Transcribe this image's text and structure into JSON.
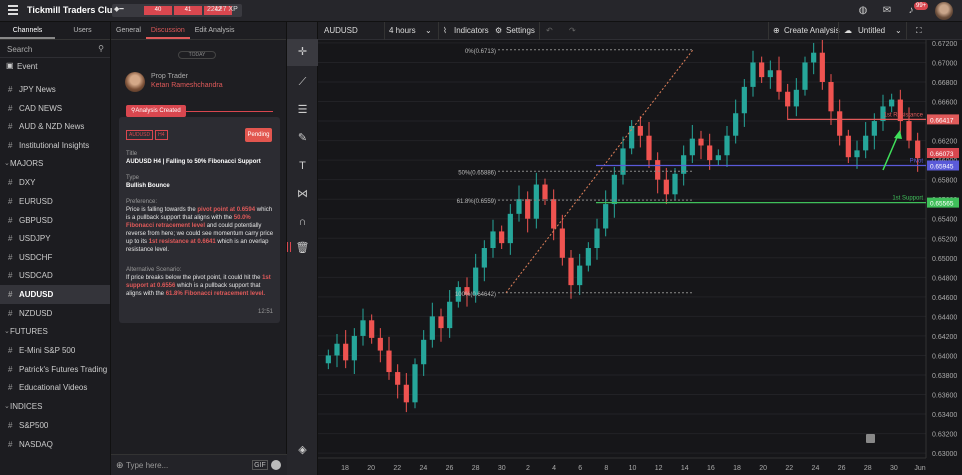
{
  "app": {
    "title": "Tickmill Traders Club",
    "xp": "22127 XP",
    "xp_segments": [
      "40",
      "41",
      "42"
    ],
    "notifications": "99+"
  },
  "sidebar": {
    "tabs": [
      "Channels",
      "Users"
    ],
    "search_placeholder": "Search",
    "event_label": "Event",
    "top_items": [
      "JPY News",
      "CAD NEWS",
      "AUD & NZD News",
      "Institutional Insights"
    ],
    "sections": [
      {
        "title": "MAJORS",
        "items": [
          "DXY",
          "EURUSD",
          "GBPUSD",
          "USDJPY",
          "USDCHF",
          "USDCAD",
          "AUDUSD",
          "NZDUSD"
        ]
      },
      {
        "title": "FUTURES",
        "items": [
          "E-Mini S&P 500",
          "Patrick's Futures Trading",
          "Educational Videos"
        ]
      },
      {
        "title": "INDICES",
        "items": [
          "S&P500",
          "NASDAQ"
        ]
      }
    ],
    "active_item": "AUDUSD"
  },
  "panel": {
    "tabs": [
      "General",
      "Discussion",
      "Edit Analysis"
    ],
    "active_tab": "Discussion",
    "today_label": "TODAY",
    "author_role": "Prop Trader",
    "author_name": "Ketan Rameshchandra",
    "created_label": "Analysis Created",
    "tags": [
      "AUDUSD",
      "H4"
    ],
    "status": "Pending",
    "title_label": "Title",
    "title_value": "AUDUSD H4 | Falling to 50% Fibonacci Support",
    "type_label": "Type",
    "type_value": "Bullish Bounce",
    "pref_label": "Preference:",
    "pref_text_1": "Price is falling towards the ",
    "pref_hl_1": "pivot point at 0.6594",
    "pref_text_2": " which is a pullback support that aligns with the ",
    "pref_hl_2": "50.0% Fibonacci retracement level",
    "pref_text_3": " and could potentially reverse from here; we could see momentum carry price up to its ",
    "pref_hl_3": "1st resistance at 0.6641",
    "pref_text_4": " which is an overlap resistance level.",
    "alt_label": "Alternative Scenario:",
    "alt_text_1": "If price breaks below the pivot point, it could hit the ",
    "alt_hl_1": "1st support at 0.6556",
    "alt_text_2": " which is a pullback support that aligns with the ",
    "alt_hl_2": "61.8% Fibonacci retracement level.",
    "time": "12:51",
    "input_placeholder": "Type here...",
    "gif_label": "GIF"
  },
  "chart_toolbar": {
    "symbol": "AUDUSD",
    "interval": "4 hours",
    "indicators": "Indicators",
    "settings": "Settings",
    "create": "Create Analysis",
    "untitled": "Untitled"
  },
  "chart_data": {
    "type": "candlestick",
    "symbol": "AUDUSD",
    "y_ticks": [
      "0.67200",
      "0.67000",
      "0.66800",
      "0.66600",
      "0.66400",
      "0.66200",
      "0.66000",
      "0.65800",
      "0.65600",
      "0.65400",
      "0.65200",
      "0.65000",
      "0.64800",
      "0.64600",
      "0.64400",
      "0.64200",
      "0.64000",
      "0.63800",
      "0.63600",
      "0.63400",
      "0.63200",
      "0.63000"
    ],
    "ylim": [
      0.6295,
      0.6723
    ],
    "x_ticks": [
      "18",
      "20",
      "22",
      "24",
      "26",
      "28",
      "30",
      "2",
      "4",
      "6",
      "8",
      "10",
      "12",
      "14",
      "16",
      "18",
      "20",
      "22",
      "24",
      "26",
      "28",
      "30",
      "Jun"
    ],
    "levels": [
      {
        "name": "1st Resistance",
        "value": 0.66417,
        "label": "0.66417",
        "color": "#e05a5a"
      },
      {
        "name": "Pivot",
        "value": 0.65945,
        "label": "0.65945",
        "color": "#5a5ad9"
      },
      {
        "name": "1st Support",
        "value": 0.65565,
        "label": "0.65565",
        "color": "#3fbf5a"
      }
    ],
    "current_price": {
      "value": 0.66073,
      "label": "0.66073"
    },
    "fib": [
      {
        "label": "0%(0.6713)",
        "value": 0.6713
      },
      {
        "label": "50%(0.65886)",
        "value": 0.65886
      },
      {
        "label": "61.8%(0.6559)",
        "value": 0.6559
      },
      {
        "label": "100%(0.64642)",
        "value": 0.64642
      }
    ],
    "colors": {
      "up": "#26a69a",
      "down": "#ef5350",
      "background": "#161619"
    },
    "closes": [
      0.64,
      0.6412,
      0.6395,
      0.642,
      0.6436,
      0.6418,
      0.6405,
      0.6383,
      0.637,
      0.6352,
      0.6391,
      0.6416,
      0.644,
      0.6428,
      0.6455,
      0.647,
      0.6462,
      0.649,
      0.651,
      0.6527,
      0.6515,
      0.6545,
      0.656,
      0.654,
      0.6575,
      0.656,
      0.653,
      0.65,
      0.6472,
      0.6492,
      0.651,
      0.653,
      0.6555,
      0.6585,
      0.6612,
      0.6635,
      0.6625,
      0.66,
      0.658,
      0.6565,
      0.6586,
      0.6605,
      0.6622,
      0.6615,
      0.66,
      0.6605,
      0.6625,
      0.6648,
      0.6675,
      0.67,
      0.6685,
      0.6692,
      0.667,
      0.6655,
      0.6672,
      0.67,
      0.671,
      0.668,
      0.665,
      0.6625,
      0.6603,
      0.661,
      0.6625,
      0.664,
      0.6655,
      0.6662,
      0.664,
      0.662,
      0.6602
    ]
  }
}
